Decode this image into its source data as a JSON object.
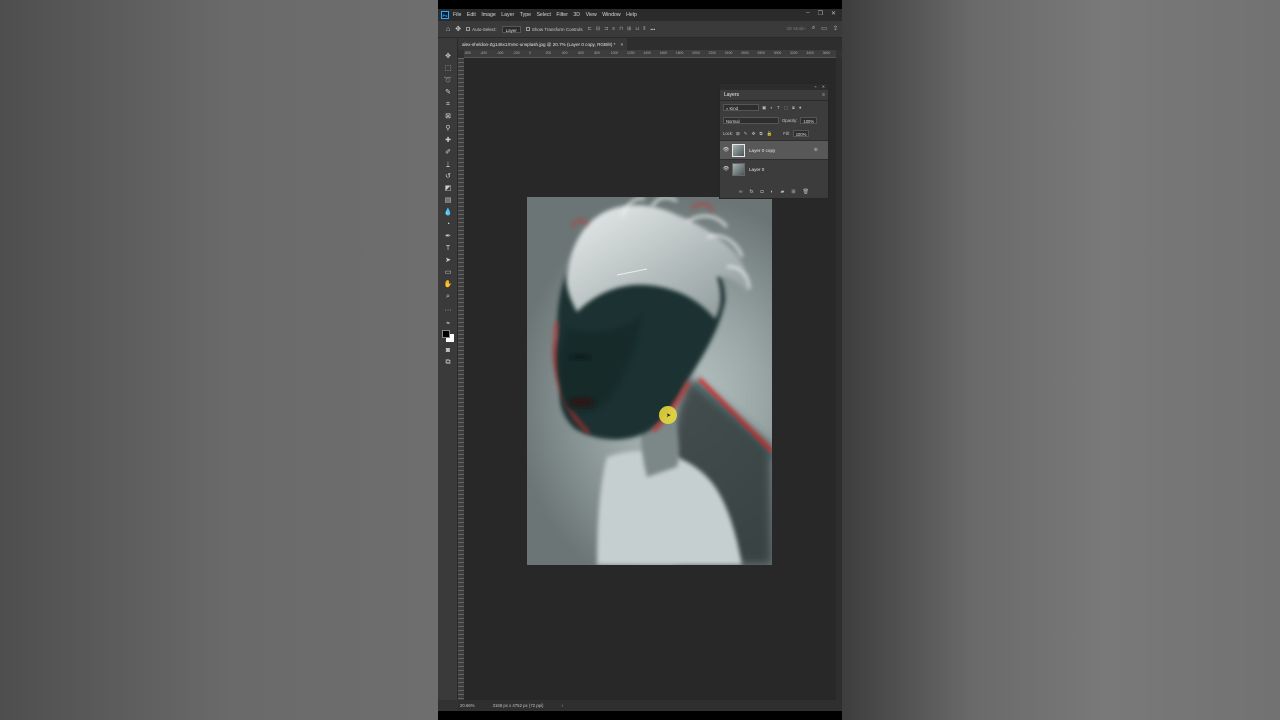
{
  "app": {
    "logo": "Ps",
    "menu": [
      "File",
      "Edit",
      "Image",
      "Layer",
      "Type",
      "Select",
      "Filter",
      "3D",
      "View",
      "Window",
      "Help"
    ]
  },
  "options": {
    "auto_select_label": "Auto-Select:",
    "auto_select_value": "Layer",
    "show_transform_label": "Show Transform Controls",
    "mode_3d_label": "3D Mode:",
    "more_label": "•••"
  },
  "document": {
    "tab_title": "alex-sheldon-Zg146x1XVec-unsplash.jpg @ 20.7% (Layer 0 copy, RGB/8) *",
    "tab_close": "×"
  },
  "ruler": {
    "ticks": [
      "-800",
      "-600",
      "-400",
      "-200",
      "0",
      "200",
      "400",
      "600",
      "800",
      "1000",
      "1200",
      "1400",
      "1600",
      "1800",
      "2000",
      "2200",
      "2400",
      "2600",
      "2800",
      "3000",
      "3200",
      "3400",
      "3600"
    ]
  },
  "status": {
    "zoom": "20.66%",
    "doc_info": "3168 px x 4752 px (72 ppi)",
    "arrow": "›"
  },
  "layers_panel": {
    "title": "Layers",
    "filter_kind": "Kind",
    "blend_mode": "Normal",
    "opacity_label": "Opacity:",
    "opacity_value": "100%",
    "lock_label": "Lock:",
    "fill_label": "Fill:",
    "fill_value": "100%",
    "layers": [
      {
        "name": "Layer 0 copy",
        "selected": true
      },
      {
        "name": "Layer 0",
        "selected": false
      }
    ]
  },
  "colors": {
    "photoshop_bg": "#323232",
    "canvas_bg": "#282828",
    "cursor_highlight": "#e6dc3c",
    "anaglyph_red": "#d22828",
    "anaglyph_cyan": "#1e5a5f"
  }
}
